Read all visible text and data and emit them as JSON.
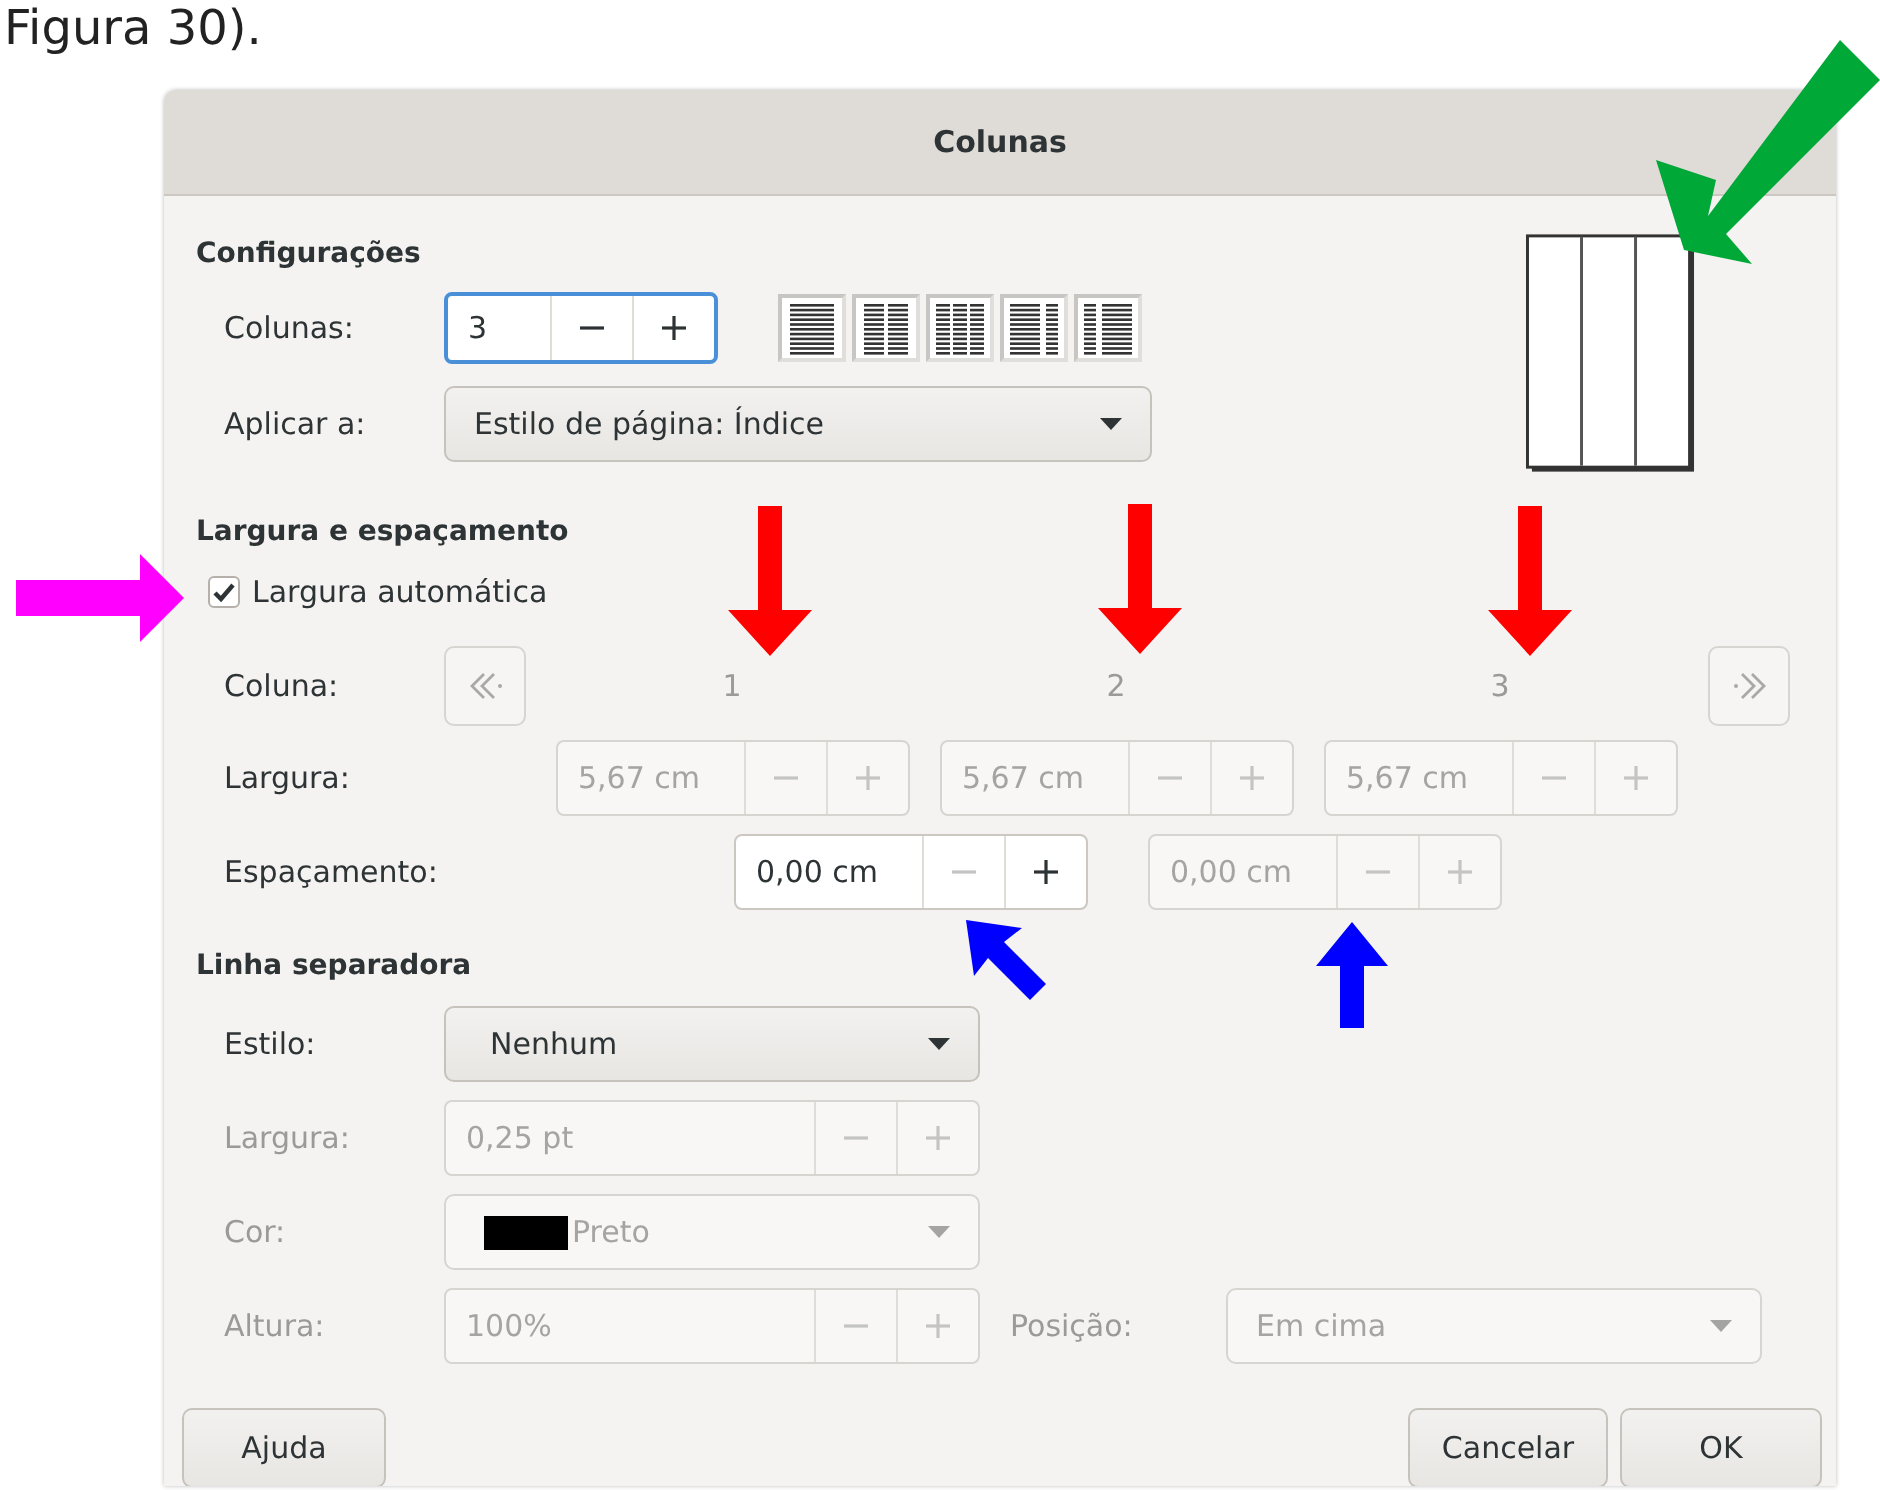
{
  "caption": "Figura 30).",
  "window": {
    "title": "Colunas"
  },
  "settings": {
    "heading": "Configurações",
    "columns": {
      "label": "Colunas:",
      "value": "3",
      "focused": true,
      "disabled": false,
      "minus_disabled": false,
      "plus_disabled": false
    },
    "presets": [
      {
        "kind": "one",
        "selected": false
      },
      {
        "kind": "two",
        "selected": false
      },
      {
        "kind": "three",
        "selected": false
      },
      {
        "kind": "left",
        "selected": false
      },
      {
        "kind": "right",
        "selected": false
      }
    ],
    "apply_to": {
      "label": "Aplicar a:",
      "value": "Estilo de página: Índice",
      "disabled": false
    }
  },
  "width_spacing": {
    "heading": "Largura e espaçamento",
    "auto_width": {
      "label": "Largura automática",
      "checked": true
    },
    "column_label": "Coluna:",
    "prev_disabled": true,
    "next_disabled": true,
    "column_numbers": [
      {
        "text": "1",
        "disabled": true
      },
      {
        "text": "2",
        "disabled": true
      },
      {
        "text": "3",
        "disabled": true
      }
    ],
    "width_label": "Largura:",
    "widths": [
      {
        "value": "5,67 cm",
        "disabled": true,
        "minus_disabled": true,
        "plus_disabled": true
      },
      {
        "value": "5,67 cm",
        "disabled": true,
        "minus_disabled": true,
        "plus_disabled": true
      },
      {
        "value": "5,67 cm",
        "disabled": true,
        "minus_disabled": true,
        "plus_disabled": true
      }
    ],
    "spacing_label": "Espaçamento:",
    "spacings": [
      {
        "value": "0,00 cm",
        "disabled": false,
        "minus_disabled": true,
        "plus_disabled": false
      },
      {
        "value": "0,00 cm",
        "disabled": true,
        "minus_disabled": true,
        "plus_disabled": true
      }
    ]
  },
  "separator": {
    "heading": "Linha separadora",
    "style": {
      "label": "Estilo:",
      "value": "Nenhum",
      "disabled": false
    },
    "width": {
      "label": "Largura:",
      "value": "0,25 pt",
      "disabled": true,
      "minus_disabled": true,
      "plus_disabled": true
    },
    "color": {
      "label": "Cor:",
      "value": "Preto",
      "color": "#000000",
      "disabled": true
    },
    "height": {
      "label": "Altura:",
      "value": "100%",
      "disabled": true,
      "minus_disabled": true,
      "plus_disabled": true
    },
    "position": {
      "label": "Posição:",
      "value": "Em cima",
      "disabled": true
    }
  },
  "buttons": [
    {
      "label": "Ajuda"
    },
    {
      "label": "Cancelar"
    },
    {
      "label": "OK"
    }
  ],
  "annotations": [
    {
      "kind": "diagonal",
      "color": "#00a838"
    },
    {
      "kind": "right",
      "color": "#ff00ff"
    },
    {
      "kind": "down",
      "color": "#ff0000"
    },
    {
      "kind": "down",
      "color": "#ff0000"
    },
    {
      "kind": "down",
      "color": "#ff0000"
    },
    {
      "kind": "upleft",
      "color": "#0000ff"
    },
    {
      "kind": "up",
      "color": "#0000ff"
    }
  ]
}
